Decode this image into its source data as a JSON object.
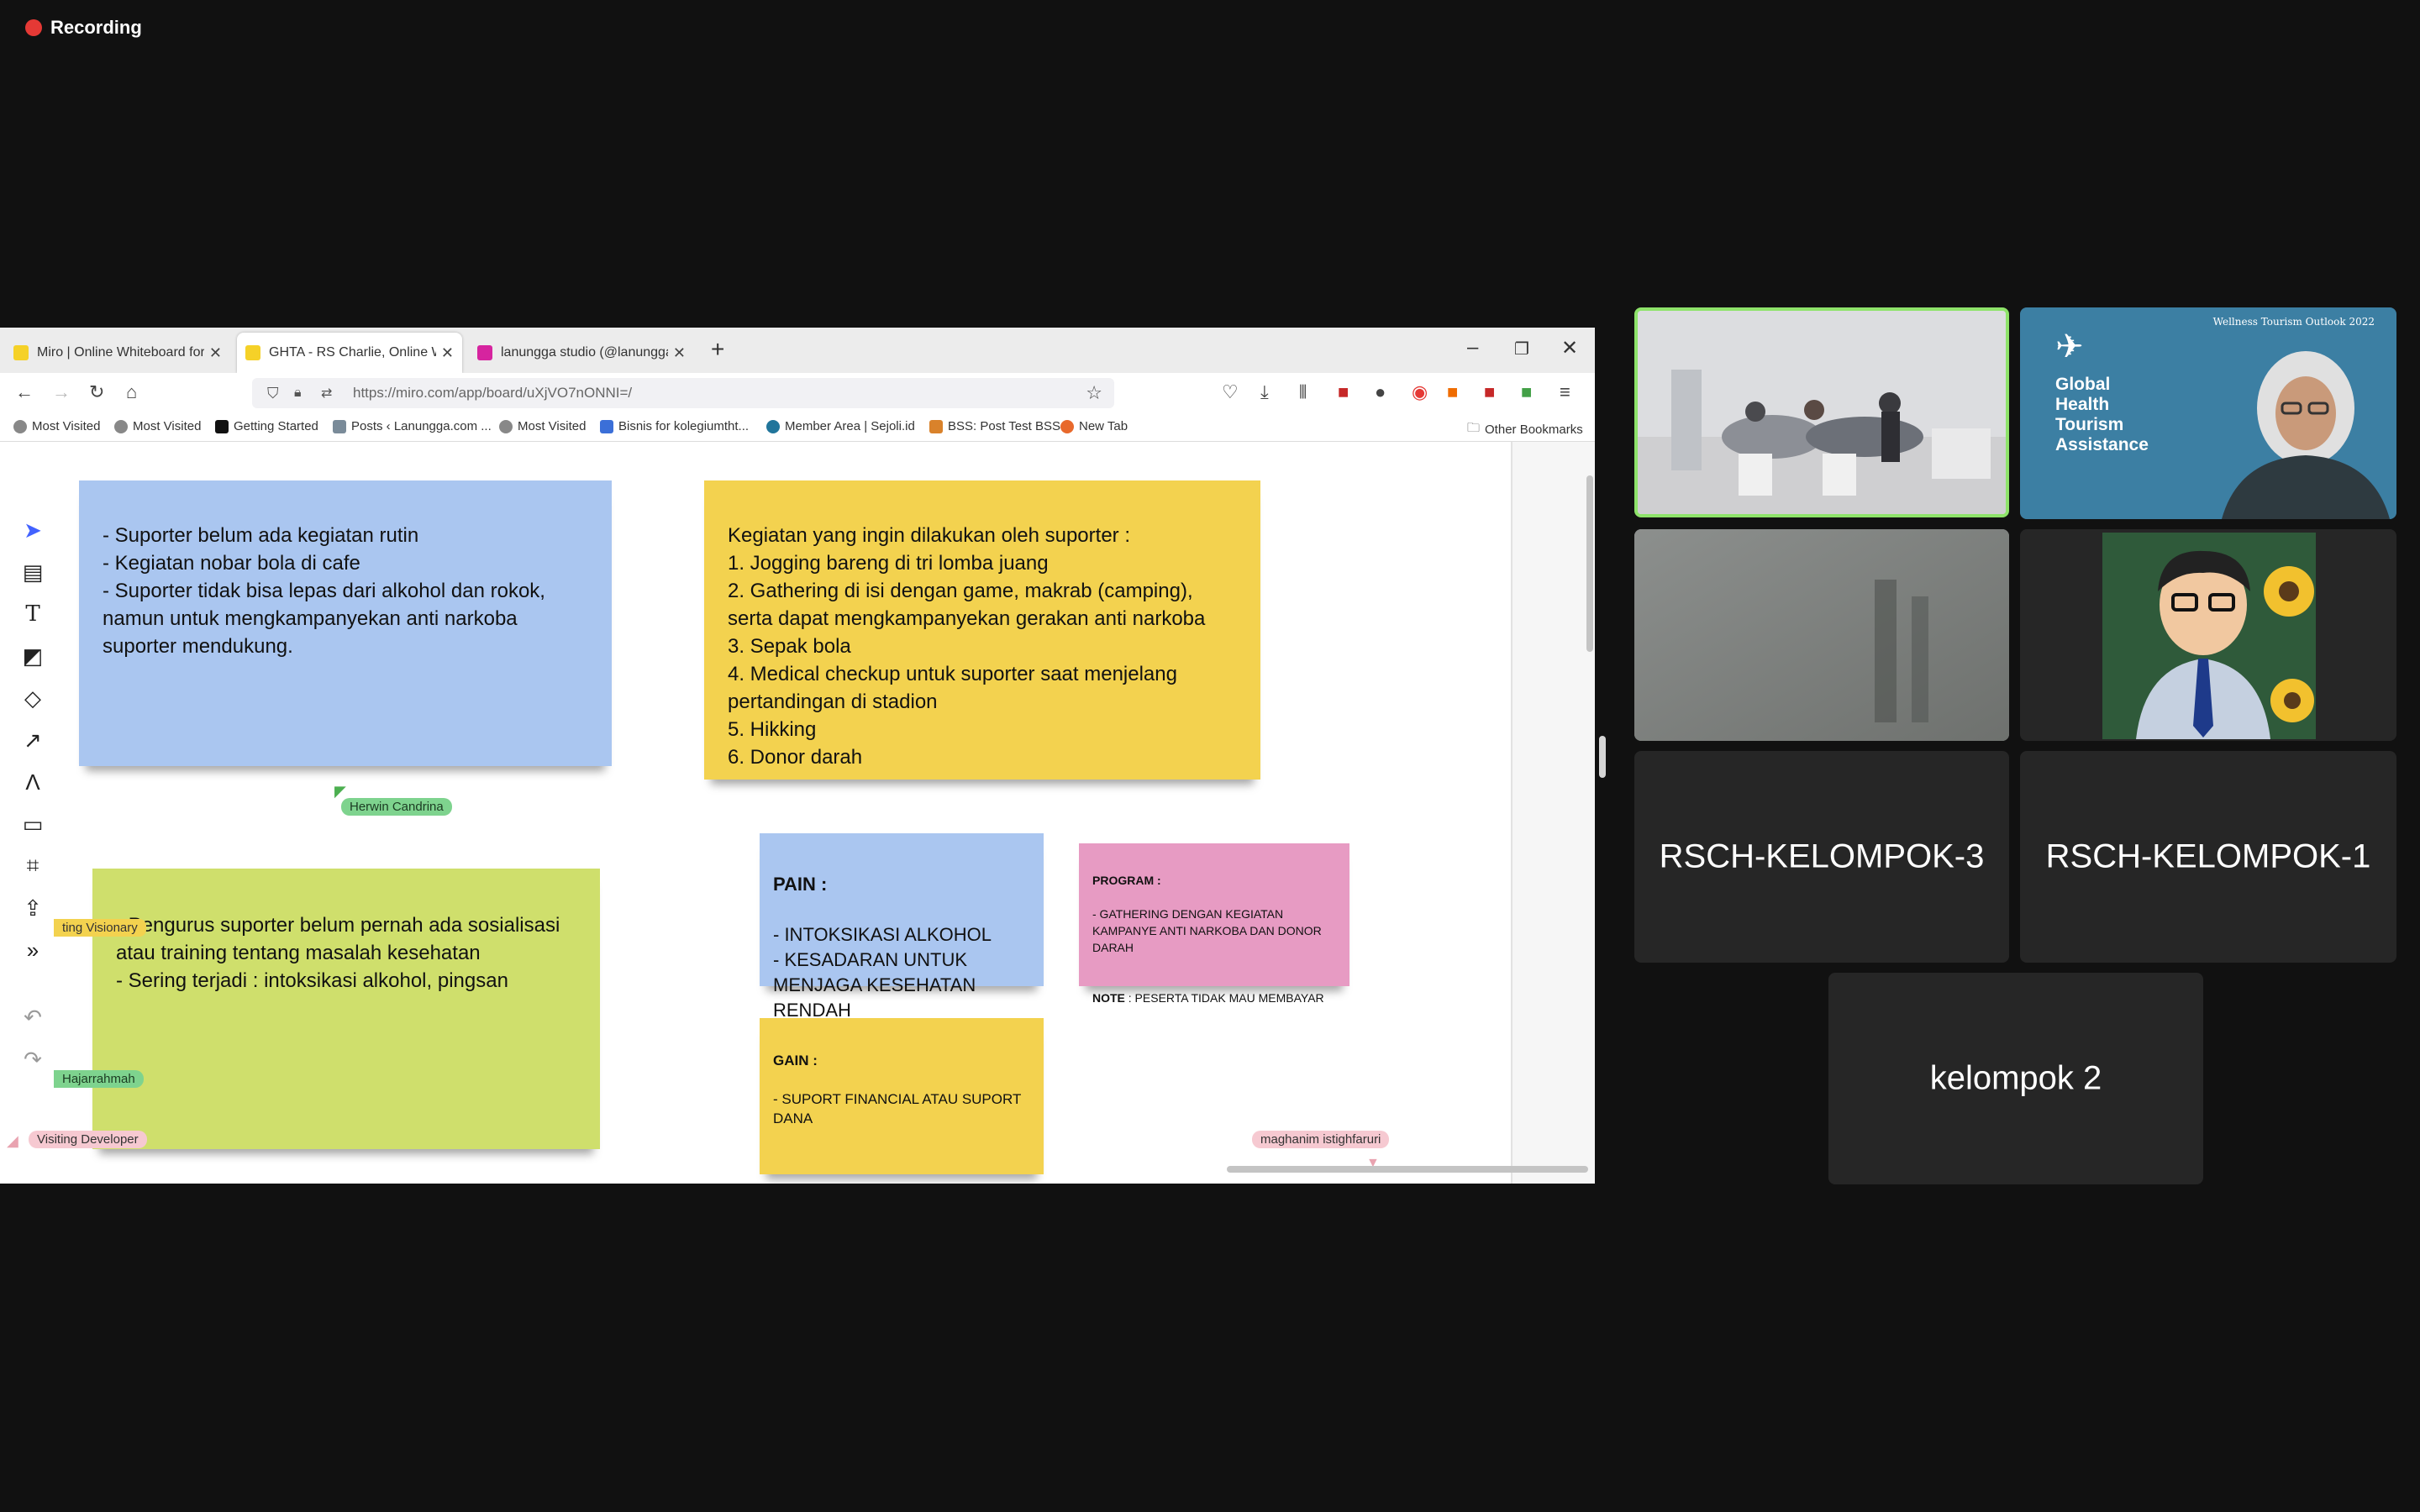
{
  "recording": {
    "label": "Recording"
  },
  "browser": {
    "tabs": [
      {
        "label": "Miro | Online Whiteboard for V",
        "favicon": "miro-icon",
        "color": "#f5d128"
      },
      {
        "label": "GHTA - RS Charlie, Online Whit",
        "favicon": "miro-icon",
        "color": "#f5d128"
      },
      {
        "label": "lanungga studio (@lanunggast",
        "favicon": "instagram-icon",
        "color": "#d6249f"
      }
    ],
    "url": "https://miro.com/app/board/uXjVO7nONNI=/",
    "bookmarks": [
      {
        "label": "Most Visited",
        "icon": "gear-icon"
      },
      {
        "label": "Most Visited",
        "icon": "gear-icon"
      },
      {
        "label": "Getting Started",
        "icon": "m-icon"
      },
      {
        "label": "Posts ‹ Lanungga.com ...",
        "icon": "site-icon"
      },
      {
        "label": "Most Visited",
        "icon": "gear-icon"
      },
      {
        "label": "Bisnis for kolegiumtht...",
        "icon": "site-icon"
      },
      {
        "label": "Member Area | Sejoli.id",
        "icon": "wordpress-icon"
      },
      {
        "label": "BSS: Post Test BSS",
        "icon": "site-icon"
      },
      {
        "label": "New Tab",
        "icon": "firefox-icon"
      }
    ],
    "other_bookmarks": "Other Bookmarks"
  },
  "board": {
    "notes": {
      "blue_top": "- Suporter belum ada kegiatan rutin\n- Kegiatan nobar bola di cafe\n- Suporter tidak bisa lepas dari alkohol dan rokok, namun untuk mengkampanyekan anti narkoba suporter mendukung.",
      "yellow_top": "Kegiatan yang ingin dilakukan oleh suporter :\n1. Jogging bareng di tri lomba juang\n2. Gathering di isi dengan game, makrab (camping), serta dapat mengkampanyekan gerakan anti narkoba\n3. Sepak bola\n4. Medical checkup untuk suporter saat menjelang pertandingan di stadion\n5. Hikking\n6. Donor darah",
      "green": "- Pengurus suporter belum pernah ada sosialisasi atau training tentang masalah kesehatan\n- Sering terjadi : intoksikasi alkohol, pingsan",
      "pain_head": "PAIN :",
      "pain_body": "- INTOKSIKASI ALKOHOL\n- KESADARAN UNTUK MENJAGA KESEHATAN RENDAH",
      "program_head": "PROGRAM :",
      "program_body": "- GATHERING DENGAN KEGIATAN KAMPANYE ANTI NARKOBA DAN DONOR DARAH",
      "note_head": "NOTE",
      "note_body": " : PESERTA TIDAK MAU MEMBAYAR",
      "gain_head": "GAIN :",
      "gain_body": "- SUPORT FINANCIAL ATAU SUPORT DANA"
    },
    "cursors": [
      {
        "label": "Herwin Candrina"
      },
      {
        "label": "ting Visionary"
      },
      {
        "label": "Hajarrahmah"
      },
      {
        "label": "Visiting Developer"
      },
      {
        "label": "maghanim istighfaruri"
      }
    ]
  },
  "participants": {
    "ghta_small": "Wellness Tourism Outlook 2022",
    "ghta_title": "Global\nHealth\nTourism\nAssistance",
    "names": [
      "RSCH-KELOMPOK-3",
      "RSCH-KELOMPOK-1",
      "kelompok 2"
    ]
  },
  "colors": {
    "note_blue": "#aac6f0",
    "note_yellow": "#f3d24f",
    "note_green": "#cfdf6c",
    "note_pink": "#e79bc3",
    "active_border": "#8ee36a"
  }
}
